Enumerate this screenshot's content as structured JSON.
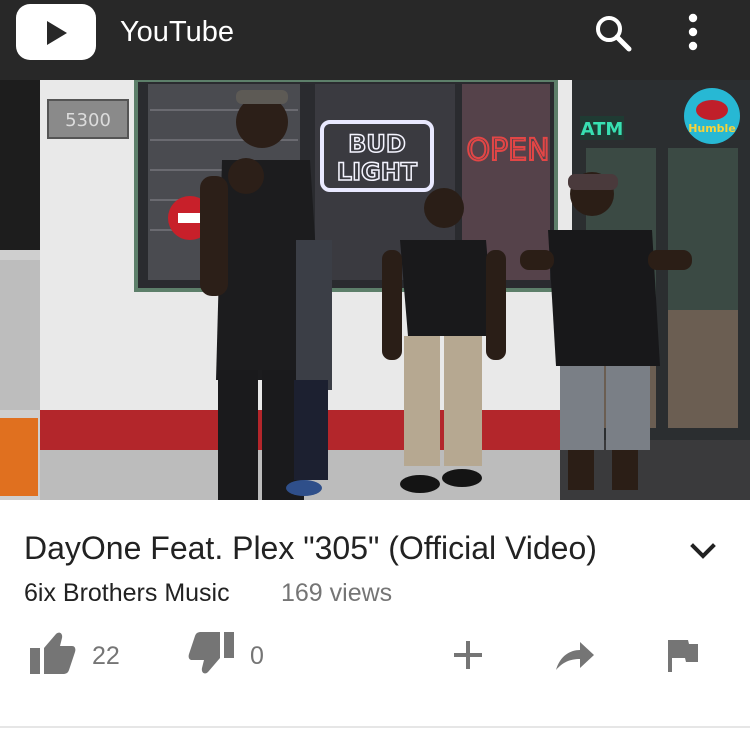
{
  "app": {
    "title": "YouTube",
    "logo_icon": "play-icon",
    "search_icon": "search-icon",
    "more_icon": "more-vert-icon",
    "bar_color": "#282828"
  },
  "player": {
    "scene_text": {
      "store_number": "5300",
      "neon_sign": [
        "BUD",
        "LIGHT"
      ],
      "open_sign": "OPEN",
      "atm_sign": "ATM",
      "watermark": "Humble"
    }
  },
  "video": {
    "title": "DayOne Feat. Plex \"305\" (Official Video)",
    "channel": "6ix Brothers Music",
    "views": "169 views",
    "expand_icon": "chevron-down-icon"
  },
  "actions": {
    "likes": "22",
    "dislikes": "0",
    "like_icon": "thumb-up-icon",
    "dislike_icon": "thumb-down-icon",
    "add_icon": "add-icon",
    "share_icon": "share-icon",
    "flag_icon": "flag-icon",
    "icon_color": "#757575"
  }
}
